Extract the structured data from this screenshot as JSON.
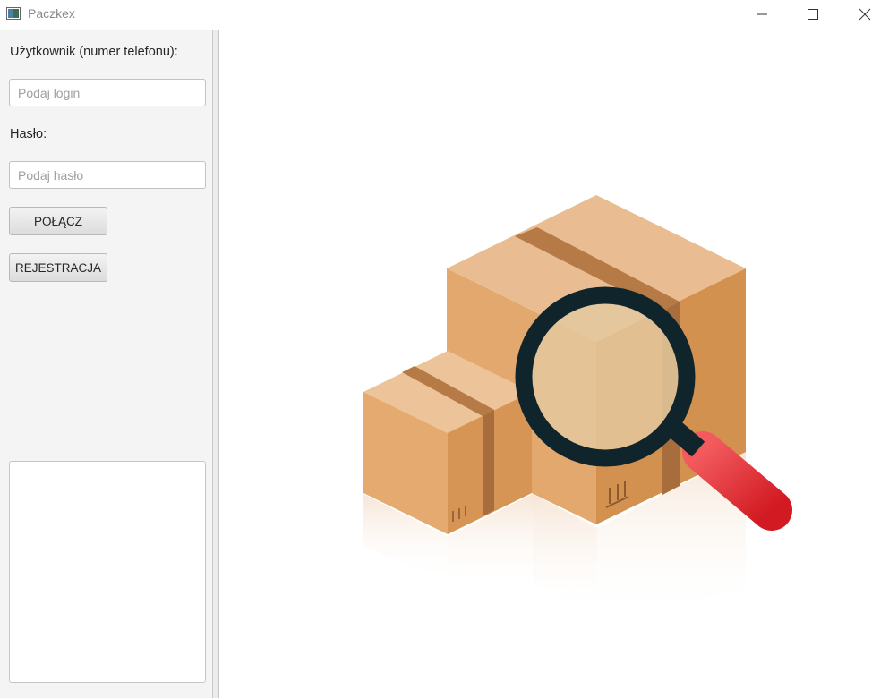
{
  "window": {
    "title": "Paczkex",
    "app_icon": "app-window-icon",
    "controls": [
      "minimize-icon",
      "maximize-icon",
      "close-icon"
    ]
  },
  "login_form": {
    "user_label": "Użytkownik (numer telefonu):",
    "user_placeholder": "Podaj login",
    "user_value": "",
    "password_label": "Hasło:",
    "password_placeholder": "Podaj hasło",
    "password_value": "",
    "connect_button": "POŁĄCZ",
    "register_button": "REJESTRACJA"
  },
  "output": {
    "text": ""
  },
  "illustration": {
    "name": "package-search-illustration",
    "colors": {
      "box_top": "#e8b98a",
      "box_left": "#e0a56a",
      "box_right": "#d08e55",
      "tape": "#b57a45",
      "lens_ring": "#10252b",
      "lens_glass": "#e6cfa8",
      "handle": "#e0272d"
    }
  }
}
